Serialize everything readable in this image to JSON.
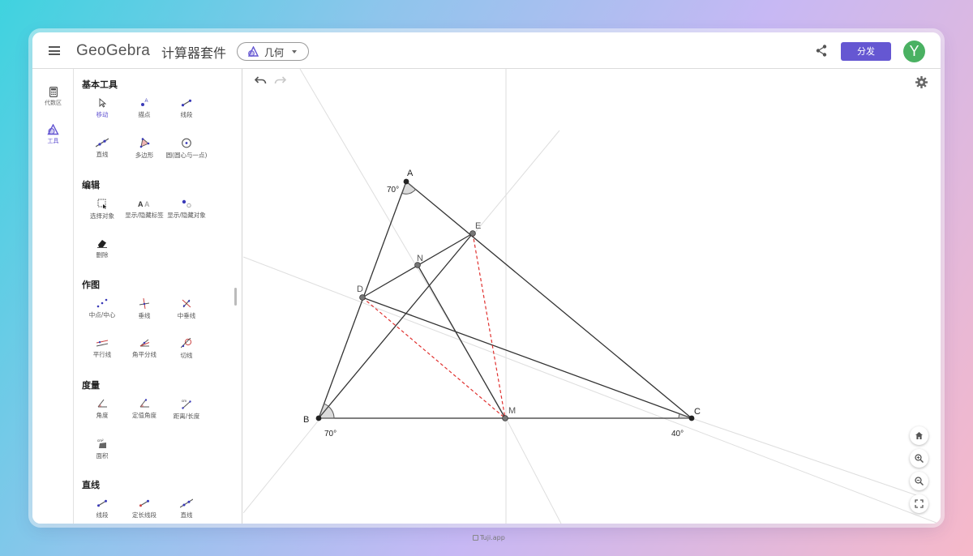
{
  "header": {
    "logo": "GeoGebra",
    "app_title": "计算器套件",
    "app_switch_label": "几何",
    "share_button": "分发",
    "avatar_letter": "Y"
  },
  "rail": {
    "algebra_label": "代数区",
    "tools_label": "工具"
  },
  "tools": {
    "groups": [
      {
        "title": "基本工具",
        "items": [
          "移动",
          "描点",
          "线段",
          "直线",
          "多边形",
          "圆(圆心与一点)"
        ]
      },
      {
        "title": "编辑",
        "items": [
          "选择对象",
          "显示/隐藏标签",
          "显示/隐藏对象",
          "删除"
        ]
      },
      {
        "title": "作图",
        "items": [
          "中点/中心",
          "垂线",
          "中垂线",
          "平行线",
          "角平分线",
          "切线"
        ]
      },
      {
        "title": "度量",
        "items": [
          "角度",
          "定值角度",
          "距离/长度",
          "面积"
        ]
      },
      {
        "title": "直线",
        "items": [
          "线段",
          "定长线段",
          "直线"
        ]
      }
    ]
  },
  "construction": {
    "points": [
      "A",
      "B",
      "C",
      "D",
      "E",
      "M",
      "N"
    ],
    "angles": {
      "A": "70°",
      "B": "70°",
      "C": "40°"
    }
  },
  "colors": {
    "accent": "#6557d2",
    "avatar": "#4ab162",
    "dashed": "#e0312f"
  },
  "watermark": "Tuji.app"
}
